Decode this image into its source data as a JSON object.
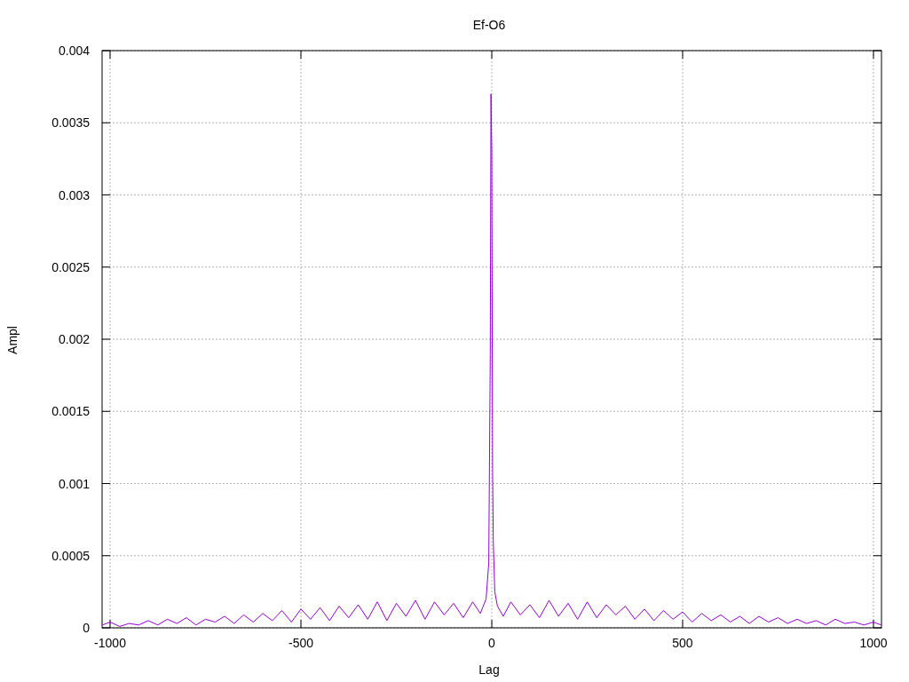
{
  "chart_data": {
    "type": "line",
    "title": "Ef-O6",
    "xlabel": "Lag",
    "ylabel": "Ampl",
    "xlim": [
      -1021,
      1021
    ],
    "ylim": [
      0,
      0.004
    ],
    "grid": true,
    "xticks": [
      -1000,
      -500,
      0,
      500,
      1000
    ],
    "yticks": [
      0,
      0.0005,
      0.001,
      0.0015,
      0.002,
      0.0025,
      0.003,
      0.0035,
      0.004
    ],
    "x": [
      -1020,
      -1000,
      -975,
      -950,
      -925,
      -900,
      -875,
      -850,
      -825,
      -800,
      -775,
      -750,
      -725,
      -700,
      -675,
      -650,
      -625,
      -600,
      -575,
      -550,
      -525,
      -500,
      -475,
      -450,
      -425,
      -400,
      -375,
      -350,
      -325,
      -300,
      -275,
      -250,
      -225,
      -200,
      -175,
      -150,
      -125,
      -100,
      -75,
      -50,
      -30,
      -15,
      -8,
      -4,
      -2,
      0,
      2,
      4,
      8,
      15,
      30,
      50,
      75,
      100,
      125,
      150,
      175,
      200,
      225,
      250,
      275,
      300,
      325,
      350,
      375,
      400,
      425,
      450,
      475,
      500,
      525,
      550,
      575,
      600,
      625,
      650,
      675,
      700,
      725,
      750,
      775,
      800,
      825,
      850,
      875,
      900,
      925,
      950,
      975,
      1000,
      1020
    ],
    "series": [
      {
        "color": "#9400d3",
        "values": [
          2e-05,
          4e-05,
          1e-05,
          3e-05,
          2e-05,
          5e-05,
          2e-05,
          6e-05,
          3e-05,
          7e-05,
          2e-05,
          6e-05,
          4e-05,
          8e-05,
          3e-05,
          9e-05,
          4e-05,
          0.0001,
          5e-05,
          0.00012,
          4e-05,
          0.00013,
          6e-05,
          0.00014,
          5e-05,
          0.00015,
          7e-05,
          0.00016,
          6e-05,
          0.00018,
          5e-05,
          0.00017,
          8e-05,
          0.00019,
          6e-05,
          0.00018,
          9e-05,
          0.00017,
          7e-05,
          0.00018,
          0.0001,
          0.0002,
          0.00045,
          0.0019,
          0.0037,
          0.0033,
          0.0011,
          0.0006,
          0.00025,
          0.00015,
          8e-05,
          0.00018,
          9e-05,
          0.00016,
          7e-05,
          0.00019,
          8e-05,
          0.00017,
          6e-05,
          0.00018,
          7e-05,
          0.00016,
          9e-05,
          0.00015,
          6e-05,
          0.00013,
          5e-05,
          0.00012,
          6e-05,
          0.00011,
          4e-05,
          0.0001,
          5e-05,
          9e-05,
          4e-05,
          8e-05,
          3e-05,
          8e-05,
          4e-05,
          7e-05,
          3e-05,
          6e-05,
          3e-05,
          5e-05,
          2e-05,
          6e-05,
          3e-05,
          4e-05,
          2e-05,
          4e-05,
          2e-05
        ]
      }
    ]
  }
}
